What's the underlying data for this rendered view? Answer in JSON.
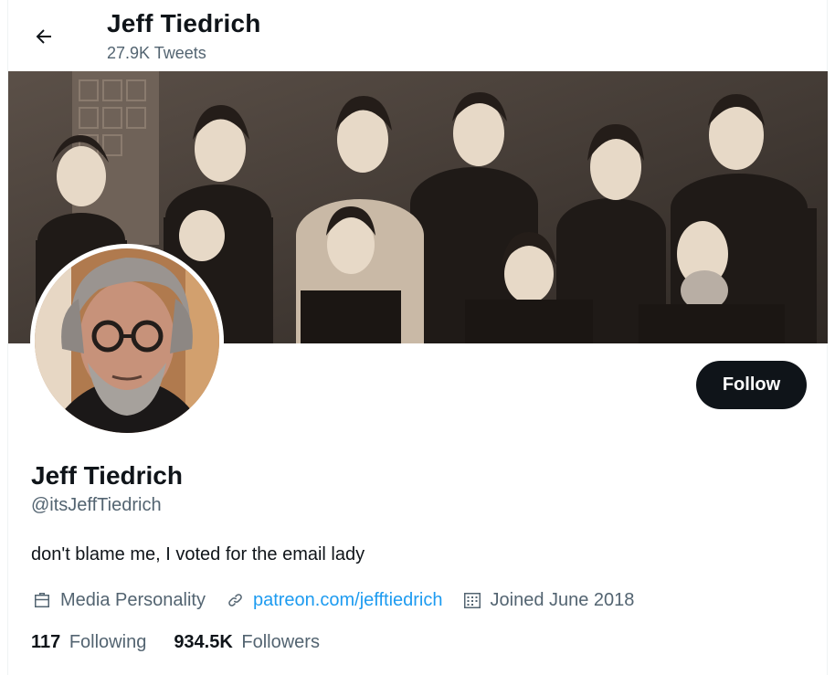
{
  "header": {
    "name": "Jeff Tiedrich",
    "tweet_count": "27.9K Tweets"
  },
  "icons": {
    "back": "arrow-left-icon",
    "profession": "briefcase-icon",
    "website": "link-icon",
    "joined": "calendar-icon"
  },
  "profile": {
    "name": "Jeff Tiedrich",
    "handle": "@itsJeffTiedrich",
    "bio": "don't blame me, I voted for the email lady",
    "profession": "Media Personality",
    "website": "patreon.com/jefftiedrich",
    "joined": "Joined June 2018",
    "following_count": "117",
    "following_label": "Following",
    "followers_count": "934.5K",
    "followers_label": "Followers"
  },
  "actions": {
    "follow_label": "Follow"
  },
  "colors": {
    "text": "#0f1419",
    "secondary": "#536471",
    "link": "#1d9bf0",
    "button_bg": "#0f1419"
  }
}
